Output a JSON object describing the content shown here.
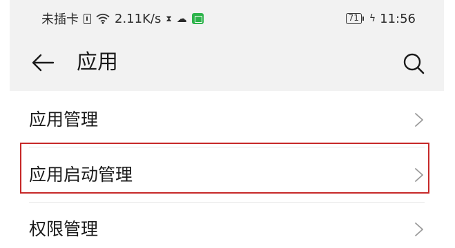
{
  "status_bar": {
    "carrier": "未插卡",
    "network_speed": "2.11K/s",
    "battery_level": "71",
    "time": "11:56",
    "icons": [
      "sim-icon",
      "wifi-icon",
      "hourglass-icon",
      "cloud-icon",
      "app-notification-icon",
      "battery-icon",
      "charging-icon"
    ]
  },
  "toolbar": {
    "title": "应用",
    "back_icon": "arrow-left-icon",
    "search_icon": "search-icon"
  },
  "list": {
    "items": [
      {
        "label": "应用管理",
        "icon": "chevron-right-icon"
      },
      {
        "label": "应用启动管理",
        "icon": "chevron-right-icon",
        "highlighted": true
      },
      {
        "label": "权限管理",
        "icon": "chevron-right-icon"
      }
    ]
  },
  "colors": {
    "header_background": "#f2f2f2",
    "highlight_border": "#c62828",
    "app_chip": "#2cb34a"
  }
}
